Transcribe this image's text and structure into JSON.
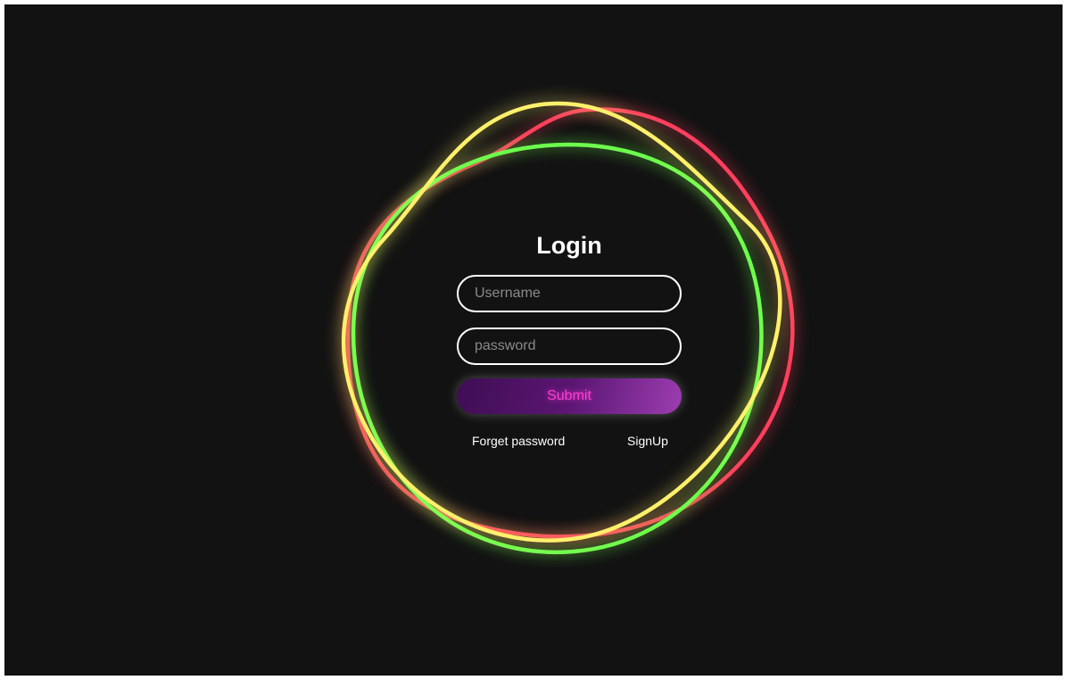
{
  "login": {
    "title": "Login",
    "username_placeholder": "Username",
    "password_placeholder": "password",
    "submit_label": "Submit",
    "forgot_password_label": "Forget password",
    "signup_label": "SignUp"
  },
  "theme": {
    "background": "#121212",
    "ring_colors": [
      "#ff3f5d",
      "#6dff4d",
      "#fff06b"
    ],
    "button_gradient": [
      "#3f0d54",
      "#9d3db1"
    ],
    "button_text": "#ff3fd2"
  }
}
